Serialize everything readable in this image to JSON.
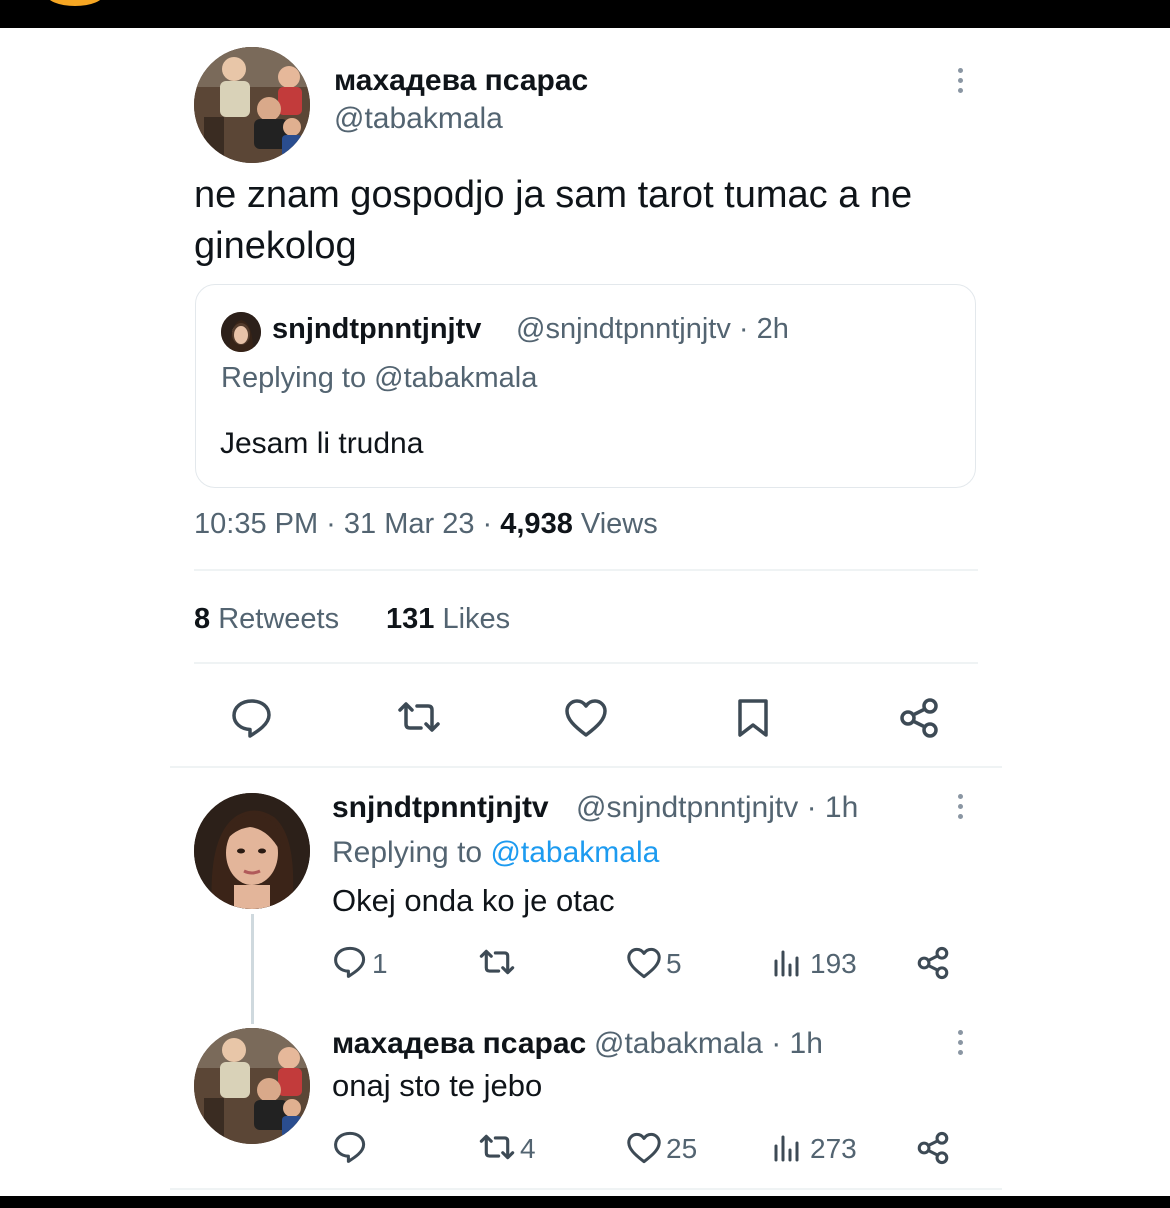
{
  "tweet": {
    "author_name": "махадева псарас",
    "author_handle": "@tabakmala",
    "text_line1": "ne znam gospodjo ja sam tarot tumac a ne",
    "text_line2": "ginekolog",
    "quoted": {
      "author_name": "snjndtpnntjnjtv",
      "author_handle_time": "@snjndtpnntjnjtv · 2h",
      "replying_to": "Replying to @tabakmala",
      "text": "Jesam li trudna"
    },
    "time": "10:35 PM · 31 Mar 23 · ",
    "views_count": "4,938",
    "views_label": " Views",
    "retweets_count": "8",
    "retweets_label": " Retweets",
    "likes_count": "131",
    "likes_label": " Likes"
  },
  "replies": [
    {
      "author_name": "snjndtpnntjnjtv",
      "author_handle_time": "@snjndtpnntjnjtv · 1h",
      "replying_prefix": "Replying to ",
      "replying_handle": "@tabakmala",
      "text": "Okej onda ko je otac",
      "reply_count": "1",
      "retweet_count": "",
      "like_count": "5",
      "view_count": "193"
    },
    {
      "author_name": "махадева псарас",
      "author_handle_time": "@tabakmala · 1h",
      "text": "onaj sto te jebo",
      "reply_count": "",
      "retweet_count": "4",
      "like_count": "25",
      "view_count": "273"
    }
  ],
  "colors": {
    "text": "#0f1419",
    "secondary": "#536471",
    "link": "#1d9bf0",
    "border": "#eff3f4"
  },
  "icons": [
    "reply-icon",
    "retweet-icon",
    "like-icon",
    "bookmark-icon",
    "share-icon",
    "views-icon",
    "more-icon"
  ]
}
